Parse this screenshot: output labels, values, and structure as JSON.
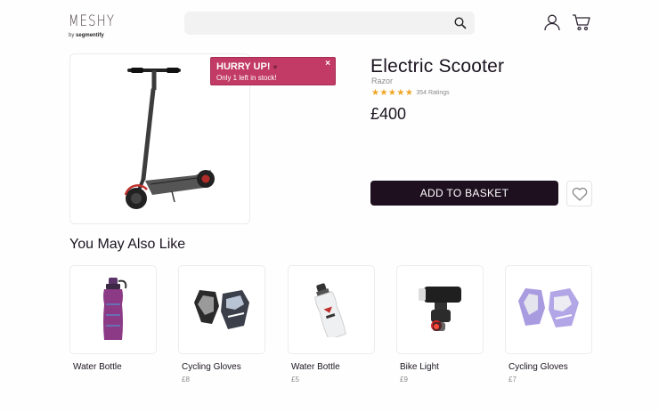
{
  "header": {
    "logo_word": "MESHY",
    "logo_sub_prefix": "by",
    "logo_sub_brand": "segmentify",
    "search": {
      "value": "",
      "placeholder": ""
    }
  },
  "promo": {
    "title": "HURRY UP!",
    "text": "Only 1 left in stock!",
    "close": "×"
  },
  "product": {
    "title": "Electric Scooter",
    "brand": "Razor",
    "stars": "★★★★★",
    "rating_value": 5,
    "rating_count": "354 Ratings",
    "price": "£400",
    "add_to_basket": "ADD TO BASKET"
  },
  "recommendations": {
    "heading": "You May Also Like",
    "items": [
      {
        "name": "Water Bottle",
        "price": ""
      },
      {
        "name": "Cycling Gloves",
        "price": "£8"
      },
      {
        "name": "Water Bottle",
        "price": "£5"
      },
      {
        "name": "Bike Light",
        "price": "£9"
      },
      {
        "name": "Cycling Gloves",
        "price": "£7"
      }
    ]
  },
  "colors": {
    "accent": "#c23b66",
    "button_dark": "#1f1020",
    "star": "#f0a524"
  }
}
